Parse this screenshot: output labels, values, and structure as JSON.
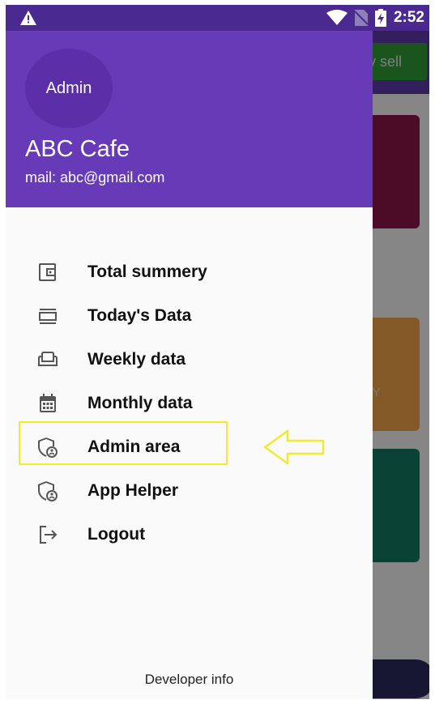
{
  "status_bar": {
    "time": "2:52",
    "icons": [
      "warning-icon",
      "wifi-icon",
      "no-sim-icon",
      "battery-charging-icon"
    ]
  },
  "background_app": {
    "sell_button_label": "y sell",
    "card_text": "Y"
  },
  "drawer": {
    "avatar_label": "Admin",
    "cafe_name": "ABC Cafe",
    "mail": "mail: abc@gmail.com",
    "items": [
      {
        "label": "Total summery",
        "icon": "wallet-icon"
      },
      {
        "label": "Today's Data",
        "icon": "view-day-icon"
      },
      {
        "label": "Weekly data",
        "icon": "weekend-icon"
      },
      {
        "label": "Monthly data",
        "icon": "calendar-icon"
      },
      {
        "label": "Admin area",
        "icon": "admin-shield-icon"
      },
      {
        "label": "App Helper",
        "icon": "admin-shield-icon"
      },
      {
        "label": "Logout",
        "icon": "logout-icon"
      }
    ],
    "footer": "Developer info"
  },
  "colors": {
    "header": "#673ab7",
    "status_bar": "#4a2a91",
    "highlight": "#f2ea2a"
  }
}
